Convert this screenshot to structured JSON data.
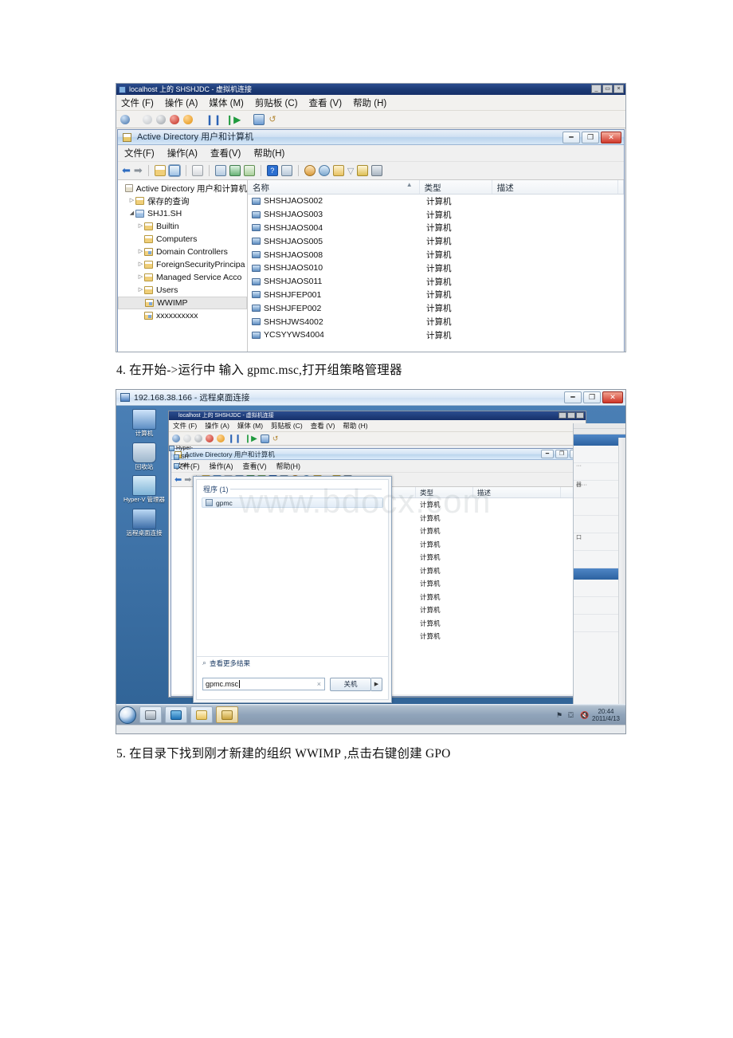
{
  "document": {
    "line4": "4. 在开始->运行中 输入 gpmc.msc,打开组策略管理器",
    "line5": "5. 在目录下找到刚才新建的组织 WWIMP ,点击右键创建 GPO"
  },
  "watermark": "www.bdocx.com",
  "figure1": {
    "vm_window": {
      "title": "localhost 上的 SHSHJDC - 虚拟机连接",
      "menu": [
        "文件 (F)",
        "操作 (A)",
        "媒体 (M)",
        "剪贴板 (C)",
        "查看 (V)",
        "帮助 (H)"
      ],
      "window_buttons": [
        "minimize",
        "maximize",
        "close"
      ],
      "toolbar_icons": [
        "ctrl-alt-del-icon",
        "power-off-icon",
        "shutdown-icon",
        "turn-off-icon",
        "start-icon",
        "pause-icon",
        "resume-icon",
        "snapshot-icon",
        "revert-icon"
      ]
    },
    "aduc_window": {
      "title": "Active Directory 用户和计算机",
      "menu": [
        "文件(F)",
        "操作(A)",
        "查看(V)",
        "帮助(H)"
      ],
      "window_buttons": [
        "minimize",
        "restore",
        "close"
      ],
      "toolbar_icons": [
        "back-icon",
        "forward-icon",
        "up-folder-icon",
        "show-tree-icon",
        "properties-icon",
        "refresh-icon",
        "export-icon",
        "help-icon",
        "console-icon",
        "new-user-icon",
        "new-group-icon",
        "new-ou-icon",
        "filter-icon",
        "find-icon",
        "delegate-icon"
      ],
      "tree": [
        {
          "label": "Active Directory 用户和计算机",
          "indent": 0,
          "expander": "",
          "icon": "console-root-icon",
          "selected": false
        },
        {
          "label": "保存的查询",
          "indent": 1,
          "expander": "▷",
          "icon": "folder-icon",
          "selected": false
        },
        {
          "label": "SHJ1.SH",
          "indent": 1,
          "expander": "◢",
          "icon": "domain-icon",
          "selected": false
        },
        {
          "label": "Builtin",
          "indent": 2,
          "expander": "▷",
          "icon": "folder-icon",
          "selected": false
        },
        {
          "label": "Computers",
          "indent": 2,
          "expander": "",
          "icon": "folder-icon",
          "selected": false
        },
        {
          "label": "Domain Controllers",
          "indent": 2,
          "expander": "▷",
          "icon": "ou-icon",
          "selected": false
        },
        {
          "label": "ForeignSecurityPrincipa",
          "indent": 2,
          "expander": "▷",
          "icon": "folder-icon",
          "selected": false
        },
        {
          "label": "Managed Service Acco",
          "indent": 2,
          "expander": "▷",
          "icon": "folder-icon",
          "selected": false
        },
        {
          "label": "Users",
          "indent": 2,
          "expander": "▷",
          "icon": "folder-icon",
          "selected": false
        },
        {
          "label": "WWIMP",
          "indent": 2,
          "expander": "",
          "icon": "ou-icon",
          "selected": true
        },
        {
          "label": "xxxxxxxxxx",
          "indent": 2,
          "expander": "",
          "icon": "ou-icon",
          "selected": false
        }
      ],
      "columns": [
        "名称",
        "类型",
        "描述",
        ""
      ],
      "rows": [
        {
          "name": "SHSHJAOS002",
          "type": "计算机",
          "desc": ""
        },
        {
          "name": "SHSHJAOS003",
          "type": "计算机",
          "desc": ""
        },
        {
          "name": "SHSHJAOS004",
          "type": "计算机",
          "desc": ""
        },
        {
          "name": "SHSHJAOS005",
          "type": "计算机",
          "desc": ""
        },
        {
          "name": "SHSHJAOS008",
          "type": "计算机",
          "desc": ""
        },
        {
          "name": "SHSHJAOS010",
          "type": "计算机",
          "desc": ""
        },
        {
          "name": "SHSHJAOS011",
          "type": "计算机",
          "desc": ""
        },
        {
          "name": "SHSHJFEP001",
          "type": "计算机",
          "desc": ""
        },
        {
          "name": "SHSHJFEP002",
          "type": "计算机",
          "desc": ""
        },
        {
          "name": "SHSHJWS4002",
          "type": "计算机",
          "desc": ""
        },
        {
          "name": "YCSYYWS4004",
          "type": "计算机",
          "desc": ""
        }
      ]
    }
  },
  "figure2": {
    "rdp_window": {
      "title": "192.168.38.166 - 远程桌面连接",
      "window_buttons": [
        "minimize",
        "restore",
        "close"
      ]
    },
    "desktop_icons": [
      {
        "label": "计算机",
        "icon": "computer-icon"
      },
      {
        "label": "回收站",
        "icon": "recycle-bin-icon"
      },
      {
        "label": "Hyper-V 管理器",
        "icon": "hyperv-manager-icon"
      },
      {
        "label": "远程桌面连接",
        "icon": "remote-desktop-icon"
      }
    ],
    "vm_window": {
      "title": "localhost 上的 SHSHJDC - 虚拟机连接",
      "menu": [
        "文件 (F)",
        "操作 (A)",
        "媒体 (M)",
        "剪贴板 (C)",
        "查看 (V)",
        "帮助 (H)"
      ]
    },
    "aduc_window": {
      "title": "Active Directory 用户和计算机",
      "menu": [
        "文件(F)",
        "操作(A)",
        "查看(V)",
        "帮助(H)"
      ],
      "columns": [
        "",
        "类型",
        "描述",
        ""
      ],
      "rows": [
        "计算机",
        "计算机",
        "计算机",
        "计算机",
        "计算机",
        "计算机",
        "计算机",
        "计算机",
        "计算机",
        "计算机",
        "计算机"
      ]
    },
    "hyperv_tree": [
      "Hyper-",
      "SH",
      "SH"
    ],
    "start_menu": {
      "group_header": "程序 (1)",
      "results": [
        {
          "label": "gpmc",
          "icon": "mmc-snapin-icon"
        }
      ],
      "see_more": "查看更多结果",
      "see_more_icon": "search-icon",
      "search_value": "gpmc.msc",
      "clear_icon": "clear-icon",
      "shutdown_label": "关机",
      "shutdown_arrow_icon": "chevron-right-icon"
    },
    "taskbar": {
      "start_orb_icon": "windows-orb-icon",
      "buttons": [
        {
          "icon": "server-manager-icon",
          "active": false
        },
        {
          "icon": "powershell-icon",
          "active": false
        },
        {
          "icon": "explorer-icon",
          "active": false
        },
        {
          "icon": "mmc-console-icon",
          "active": true
        }
      ],
      "tray_icons": [
        "network-icon",
        "action-center-icon",
        "volume-muted-icon"
      ],
      "clock_time": "20:44",
      "clock_date": "2011/4/13"
    }
  }
}
